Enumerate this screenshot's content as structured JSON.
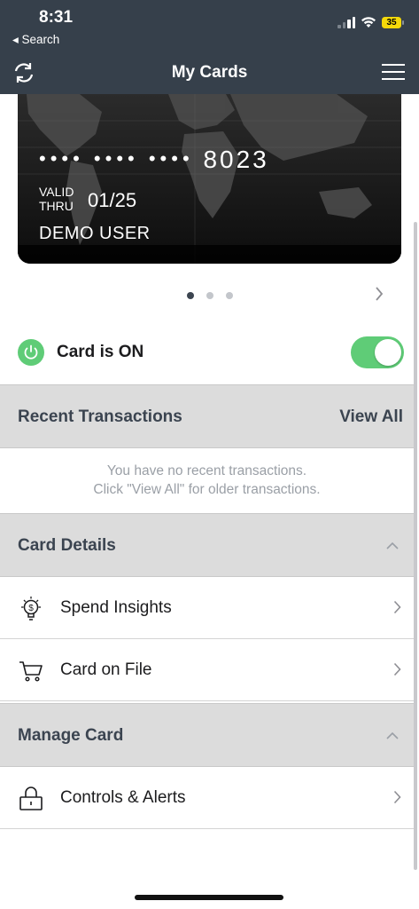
{
  "status_bar": {
    "time": "8:31",
    "back_label": "◂ Search",
    "battery": "35"
  },
  "nav": {
    "title": "My Cards",
    "left_icon": "refresh-icon",
    "right_icon": "menu-icon"
  },
  "card": {
    "masked_dots": "•••• •••• ••••",
    "last4": "8023",
    "valid_thru_label_line1": "VALID",
    "valid_thru_label_line2": "THRU",
    "expiry": "01/25",
    "holder": "DEMO USER"
  },
  "pager": {
    "count": 3,
    "active_index": 0
  },
  "card_toggle": {
    "label": "Card is ON",
    "on": true,
    "accent": "#5fcc77"
  },
  "recent_transactions": {
    "title": "Recent Transactions",
    "view_all": "View All",
    "empty_line1": "You have no recent transactions.",
    "empty_line2": "Click \"View All\" for older transactions."
  },
  "card_details": {
    "title": "Card Details",
    "items": [
      {
        "label": "Spend Insights",
        "icon": "lightbulb-dollar-icon"
      },
      {
        "label": "Card on File",
        "icon": "cart-icon"
      }
    ]
  },
  "manage_card": {
    "title": "Manage Card",
    "items": [
      {
        "label": "Controls & Alerts",
        "icon": "lock-icon"
      }
    ]
  },
  "colors": {
    "header_bg": "#36404b",
    "section_bg": "#dcdcdc",
    "section_text": "#3b4450",
    "toggle_on": "#5fcc77"
  }
}
